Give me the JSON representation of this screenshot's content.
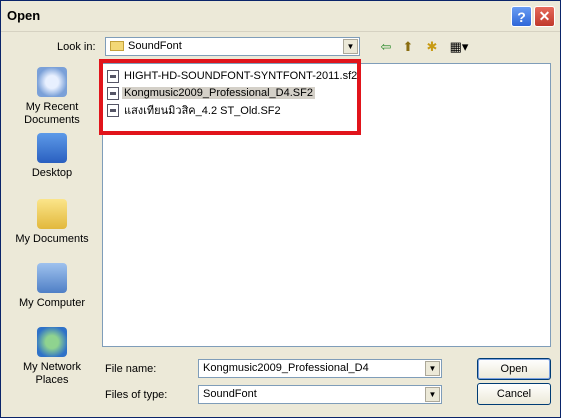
{
  "window": {
    "title": "Open"
  },
  "titlebar": {
    "help_glyph": "?",
    "close_glyph": "✕"
  },
  "lookin": {
    "label": "Look in:",
    "value": "SoundFont"
  },
  "toolbar": {
    "back_glyph": "⇦",
    "up_glyph": "⬆",
    "new_glyph": "✱",
    "views_glyph": "▦▾"
  },
  "places": [
    {
      "label": "My Recent Documents",
      "icon": "recent-documents-icon"
    },
    {
      "label": "Desktop",
      "icon": "desktop-icon"
    },
    {
      "label": "My Documents",
      "icon": "my-documents-icon"
    },
    {
      "label": "My Computer",
      "icon": "my-computer-icon"
    },
    {
      "label": "My Network Places",
      "icon": "network-places-icon"
    }
  ],
  "files": [
    {
      "name": "HIGHT-HD-SOUNDFONT-SYNTFONT-2011.sf2",
      "selected": false
    },
    {
      "name": "Kongmusic2009_Professional_D4.SF2",
      "selected": true
    },
    {
      "name": "แสงเทียนมิวสิค_4.2 ST_Old.SF2",
      "selected": false
    }
  ],
  "filename": {
    "label": "File name:",
    "value": "Kongmusic2009_Professional_D4"
  },
  "filetype": {
    "label": "Files of type:",
    "value": "SoundFont"
  },
  "buttons": {
    "open": "Open",
    "cancel": "Cancel"
  },
  "colors": {
    "highlight": "#e1141b",
    "selection": "#d4d0c8"
  }
}
